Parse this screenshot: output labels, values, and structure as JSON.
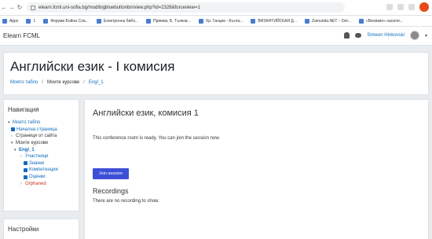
{
  "browser": {
    "url": "elearn.fcml.uni-sofia.bg/mod/bigbluebuttonbn/view.php?id=2328&forceview=1",
    "bookmarks": [
      "Apps",
      "1",
      "Форуми Бойна Сла...",
      "Електронна библ...",
      "Примов, Б. Тълков...",
      "Хр. Ганцев - Бълга...",
      "ВИЗАНТИЙСКАЯ Д...",
      "Zamunda.NET :: Det...",
      "«Великие» насиля..."
    ]
  },
  "navbar": {
    "brand": "Elearn FCML",
    "user_name": "Simeon Hinkovski"
  },
  "header": {
    "title": "Английски език - I комисия",
    "breadcrumb": [
      "Моето табло",
      "Моите курсове",
      "Engl_1"
    ]
  },
  "navigation": {
    "title": "Навигация",
    "items": [
      {
        "label": "Моето табло",
        "style": "link"
      },
      {
        "label": "Начална страница",
        "style": "link"
      },
      {
        "label": "Страници от сайта",
        "style": "plain"
      },
      {
        "label": "Моите курсове",
        "style": "plain"
      },
      {
        "label": "Engl_1",
        "style": "link"
      },
      {
        "label": "Участници",
        "style": "link"
      },
      {
        "label": "Значки",
        "style": "link"
      },
      {
        "label": "Компетенции",
        "style": "link"
      },
      {
        "label": "Оценки",
        "style": "link"
      },
      {
        "label": "Orphaned",
        "style": "orph"
      }
    ]
  },
  "settings": {
    "title": "Настройки"
  },
  "main": {
    "room_title": "Английски език, комисия 1",
    "room_message": "This conference room is ready. You can join the session now.",
    "join_label": "Join session",
    "recordings_title": "Recordings",
    "recordings_message": "There are no recording to show."
  }
}
